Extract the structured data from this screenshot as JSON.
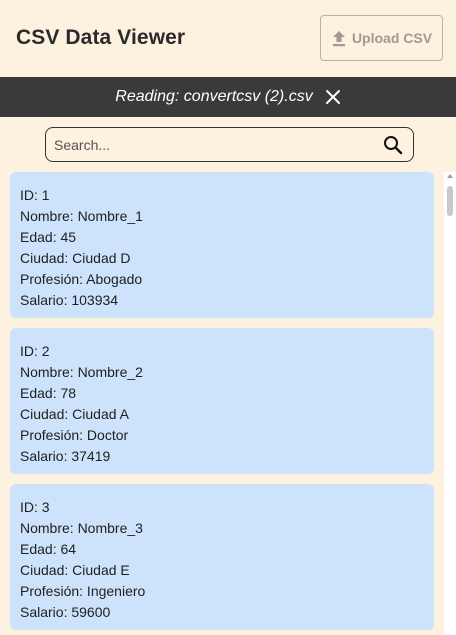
{
  "header": {
    "title": "CSV Data Viewer",
    "upload_label": "Upload CSV"
  },
  "reading_bar": {
    "text": "Reading: convertcsv (2).csv"
  },
  "search": {
    "placeholder": "Search..."
  },
  "records": [
    {
      "id": "ID: 1",
      "nombre": "Nombre: Nombre_1",
      "edad": "Edad: 45",
      "ciudad": "Ciudad: Ciudad D",
      "profesion": "Profesión: Abogado",
      "salario": "Salario: 103934"
    },
    {
      "id": "ID: 2",
      "nombre": "Nombre: Nombre_2",
      "edad": "Edad: 78",
      "ciudad": "Ciudad: Ciudad A",
      "profesion": "Profesión: Doctor",
      "salario": "Salario: 37419"
    },
    {
      "id": "ID: 3",
      "nombre": "Nombre: Nombre_3",
      "edad": "Edad: 64",
      "ciudad": "Ciudad: Ciudad E",
      "profesion": "Profesión: Ingeniero",
      "salario": "Salario: 59600"
    }
  ],
  "colors": {
    "background": "#fdf1df",
    "card": "#cce3fb",
    "reading_bar": "#3a3a3a"
  },
  "icons": {
    "upload": "upload-icon",
    "close": "close-icon",
    "search": "search-icon"
  }
}
